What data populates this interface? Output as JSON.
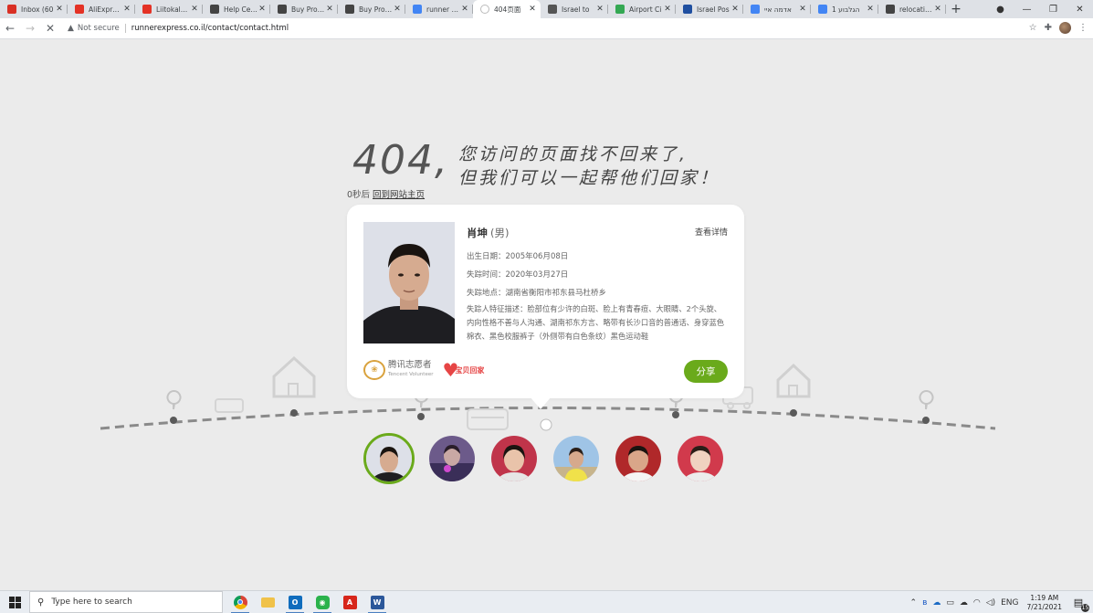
{
  "browser": {
    "tabs": [
      {
        "title": "Inbox (60",
        "favicon": "gmail-icon",
        "color": "#d93025"
      },
      {
        "title": "AliExpress",
        "favicon": "aliexpress-icon",
        "color": "#e43225"
      },
      {
        "title": "Liitokala n",
        "favicon": "aliexpress-icon",
        "color": "#e43225"
      },
      {
        "title": "Help Cent",
        "favicon": "help-icon",
        "color": "#444444"
      },
      {
        "title": "Buy Produ",
        "favicon": "globe-icon",
        "color": "#444444"
      },
      {
        "title": "Buy Produ",
        "favicon": "globe-icon",
        "color": "#444444"
      },
      {
        "title": "runner exp",
        "favicon": "google-icon",
        "color": "#4285f4"
      },
      {
        "title": "404页面",
        "favicon": "loading-icon",
        "color": "#888888",
        "active": true
      },
      {
        "title": "Israel to",
        "favicon": "mail-icon",
        "color": "#555555"
      },
      {
        "title": "Airport Ci",
        "favicon": "maps-icon",
        "color": "#34a853"
      },
      {
        "title": "Israel Pos",
        "favicon": "israel-flag-icon",
        "color": "#1f4fa0"
      },
      {
        "title": "אדמה איי",
        "favicon": "google-icon",
        "color": "#4285f4"
      },
      {
        "title": "הגלבוע 1",
        "favicon": "google-icon",
        "color": "#4285f4"
      },
      {
        "title": "relocation",
        "favicon": "globe-icon",
        "color": "#444444"
      }
    ],
    "new_tab": "+",
    "security_label": "Not secure",
    "url": "runnerexpress.co.il/contact/contact.html"
  },
  "page": {
    "code": "404,",
    "slogan_line1": "您访问的页面找不回来了,",
    "slogan_line2": "但我们可以一起帮他们回家！",
    "redirect_prefix": "0秒后",
    "redirect_link": "回到网站主页",
    "card": {
      "name": "肖坤",
      "gender": "(男)",
      "detail_link": "查看详情",
      "birth": "出生日期：2005年06月08日",
      "missing_time": "失踪时间：2020年03月27日",
      "missing_place": "失踪地点：湖南省衡阳市祁东县马杜桥乡",
      "description": "失踪人特征描述：脸部位有少许的白斑、脸上有青春痘、大眼睛、2个头旋、内向性格不善与人沟通、湖南祁东方言、略带有长沙口音的普通话、身穿蓝色棉衣、黑色校服裤子（外侧带有白色条纹）黑色运动鞋",
      "logo_tencent_cn": "腾讯志愿者",
      "logo_tencent_en": "Tencent Volunteer",
      "logo_baobei": "宝贝回家",
      "share_label": "分享"
    },
    "thumbs_count": 6
  },
  "taskbar": {
    "search_placeholder": "Type here to search",
    "lang": "ENG",
    "time": "1:19 AM",
    "date": "7/21/2021",
    "notif_count": "15"
  },
  "colors": {
    "accent_green": "#6aaa1b",
    "page_bg": "#ebebeb",
    "road": "#8a8a8a"
  }
}
